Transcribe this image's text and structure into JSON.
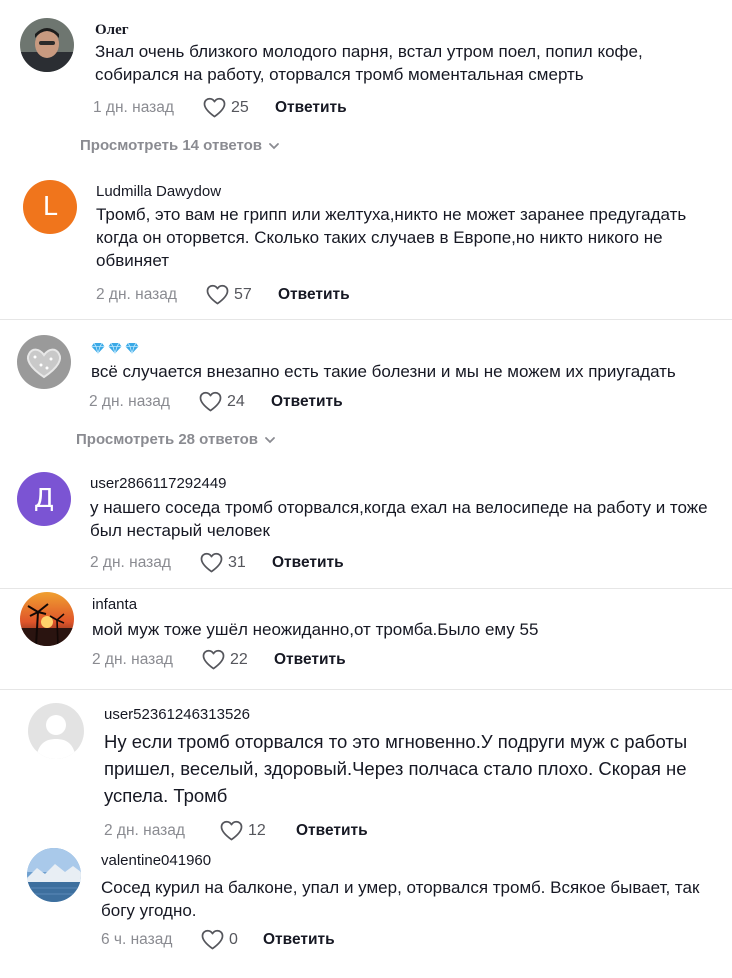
{
  "comments": [
    {
      "name": "Олег",
      "text": "Знал очень близкого молодого парня, встал утром поел, попил кофе, собирался на работу, оторвался тромб моментальная смерть",
      "time": "1 дн. назад",
      "likes": "25",
      "reply": "Ответить",
      "view_replies": "Просмотреть 14 ответов"
    },
    {
      "name": "Ludmilla Dawydow",
      "avatar_letter": "L",
      "avatar_color": "#f0751c",
      "text": "Тромб, это вам не грипп или желтуха,никто не может заранее предугадать когда он оторвется. Сколько таких случаев в Европе,но никто никого не обвиняет",
      "time": "2 дн. назад",
      "likes": "57",
      "reply": "Ответить"
    },
    {
      "name_icons": [
        "gem-icon",
        "gem-icon",
        "gem-icon"
      ],
      "text": "всё случается внезапно есть такие болезни и мы не можем их приугадать",
      "time": "2 дн. назад",
      "likes": "24",
      "reply": "Ответить",
      "view_replies": "Просмотреть 28 ответов"
    },
    {
      "name": "user2866117292449",
      "avatar_letter": "Д",
      "avatar_color": "#7b54d3",
      "text": "у нашего соседа тромб оторвался,когда ехал на велосипеде на работу и тоже был нестарый человек",
      "time": "2 дн. назад",
      "likes": "31",
      "reply": "Ответить"
    },
    {
      "name": "infanta",
      "text": "мой муж тоже ушёл неожиданно,от тромба.Было ему 55",
      "time": "2 дн. назад",
      "likes": "22",
      "reply": "Ответить"
    },
    {
      "name": "user52361246313526",
      "text": "Ну если тромб оторвался то это мгновенно.У подруги муж с работы пришел, веселый, здоровый.Через полчаса стало плохо. Скорая не успела. Тромб",
      "time": "2 дн. назад",
      "likes": "12",
      "reply": "Ответить"
    },
    {
      "name": "valentine041960",
      "text": "Сосед курил на балконе, упал и умер, оторвался тромб. Всякое бывает, так богу угодно.",
      "time": "6 ч. назад",
      "likes": "0",
      "reply": "Ответить"
    }
  ],
  "colors": {
    "text": "#161823",
    "muted": "#8a8b91",
    "divider": "#e6e6e6"
  }
}
